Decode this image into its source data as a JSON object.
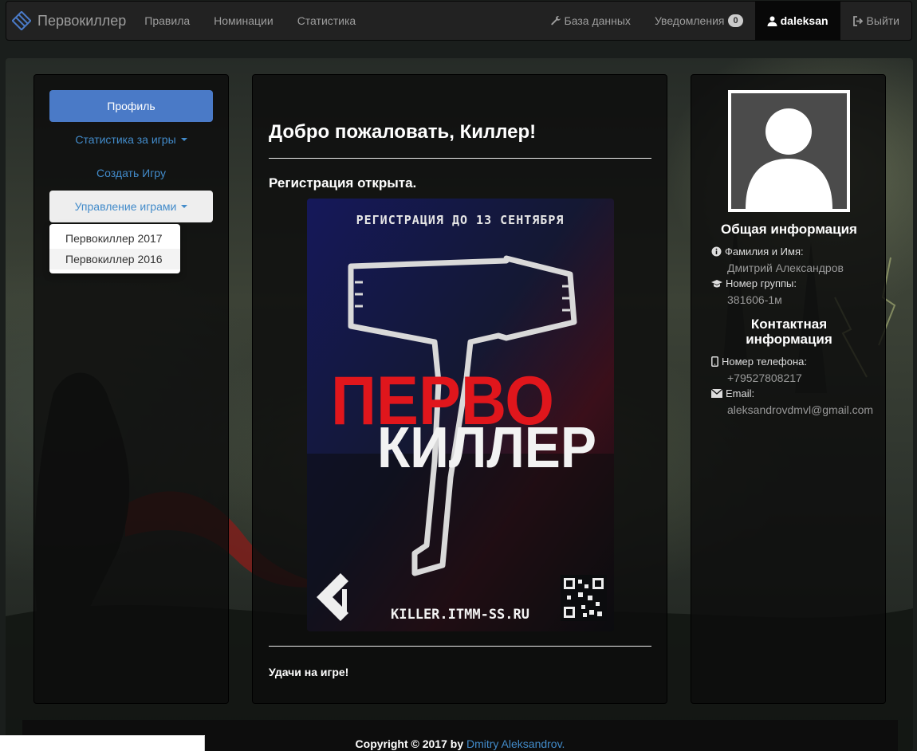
{
  "navbar": {
    "brand": "Первокиллер",
    "links": [
      "Правила",
      "Номинации",
      "Статистика"
    ],
    "database": "База данных",
    "notifications": "Уведомления",
    "notifications_count": "0",
    "user": "daleksan",
    "logout": "Выйти"
  },
  "sidebar": {
    "profile": "Профиль",
    "stats": "Статистика за игры",
    "create_game": "Создать Игру",
    "manage_games": "Управление играми",
    "dropdown": [
      "Первокиллер 2017",
      "Первокиллер 2016"
    ]
  },
  "main": {
    "welcome": "Добро пожаловать, Киллер!",
    "registration": "Регистрация открыта.",
    "poster": {
      "top_text": "РЕГИСТРАЦИЯ ДО 13 СЕНТЯБРЯ",
      "word1": "ПЕРВО",
      "word2": "КИЛЛЕР",
      "url": "KILLER.ITMM-SS.RU"
    },
    "good_luck": "Удачи на игре!"
  },
  "profile": {
    "general_title": "Общая информация",
    "name_label": "Фамилия и Имя:",
    "name": "Дмитрий Александров",
    "group_label": "Номер группы:",
    "group": "381606-1м",
    "contact_title_line1": "Контактная",
    "contact_title_line2": "информация",
    "phone_label": "Номер телефона:",
    "phone": "+79527808217",
    "email_label": "Email:",
    "email": "aleksandrovdmvl@gmail.com"
  },
  "footer": {
    "copyright": "Copyright © 2017 by",
    "author": "Dmitry Aleksandrov."
  },
  "colors": {
    "accent": "#428bca",
    "primary_button": "#4a7ac7",
    "poster_red": "#e0161c"
  }
}
